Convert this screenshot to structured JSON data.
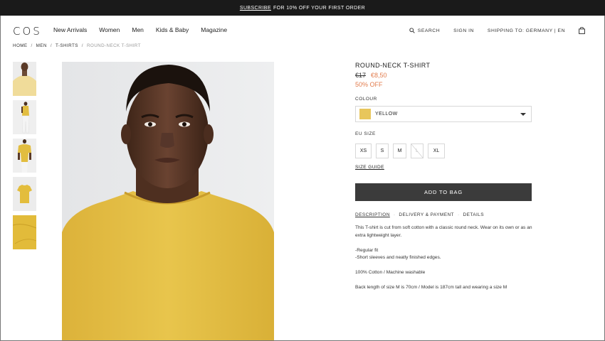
{
  "promo": {
    "link": "SUBSCRIBE",
    "text": "FOR 10% OFF YOUR FIRST ORDER"
  },
  "header": {
    "logo": "COS",
    "nav": [
      "New Arrivals",
      "Women",
      "Men",
      "Kids & Baby",
      "Magazine"
    ],
    "search": "SEARCH",
    "signin": "SIGN IN",
    "shipping": "SHIPPING TO: GERMANY | EN",
    "icons": {
      "search": "search-icon",
      "bag": "shopping-bag-icon"
    }
  },
  "breadcrumb": [
    "HOME",
    "MEN",
    "T-SHIRTS",
    "ROUND-NECK T-SHIRT"
  ],
  "product": {
    "title": "ROUND-NECK T-SHIRT",
    "old_price": "€17",
    "new_price": "€8,50",
    "discount": "50% OFF",
    "colour_label": "COLOUR",
    "colour_value": "YELLOW",
    "colour_hex": "#e8c65c",
    "size_label": "EU SIZE",
    "sizes": [
      "XS",
      "S",
      "M",
      "L",
      "XL"
    ],
    "size_guide": "SIZE GUIDE",
    "add_to_bag": "ADD TO BAG",
    "tabs": [
      "DESCRIPTION",
      "DELIVERY & PAYMENT",
      "DETAILS"
    ],
    "description": [
      "This T-shirt is cut from soft cotton with a classic round neck. Wear on its own or as an extra lightweight layer.",
      "-Regular fit",
      "-Short sleeves and neatly finished edges.",
      "100% Cotton / Machine washable",
      "Back length of size M is 70cm / Model is 187cm tall and wearing a size M"
    ]
  },
  "colors": {
    "accent_sale": "#e27c4d",
    "button": "#3b3b3b",
    "promo_bar": "#1a1a1a",
    "shirt": "#e5bf3f"
  }
}
